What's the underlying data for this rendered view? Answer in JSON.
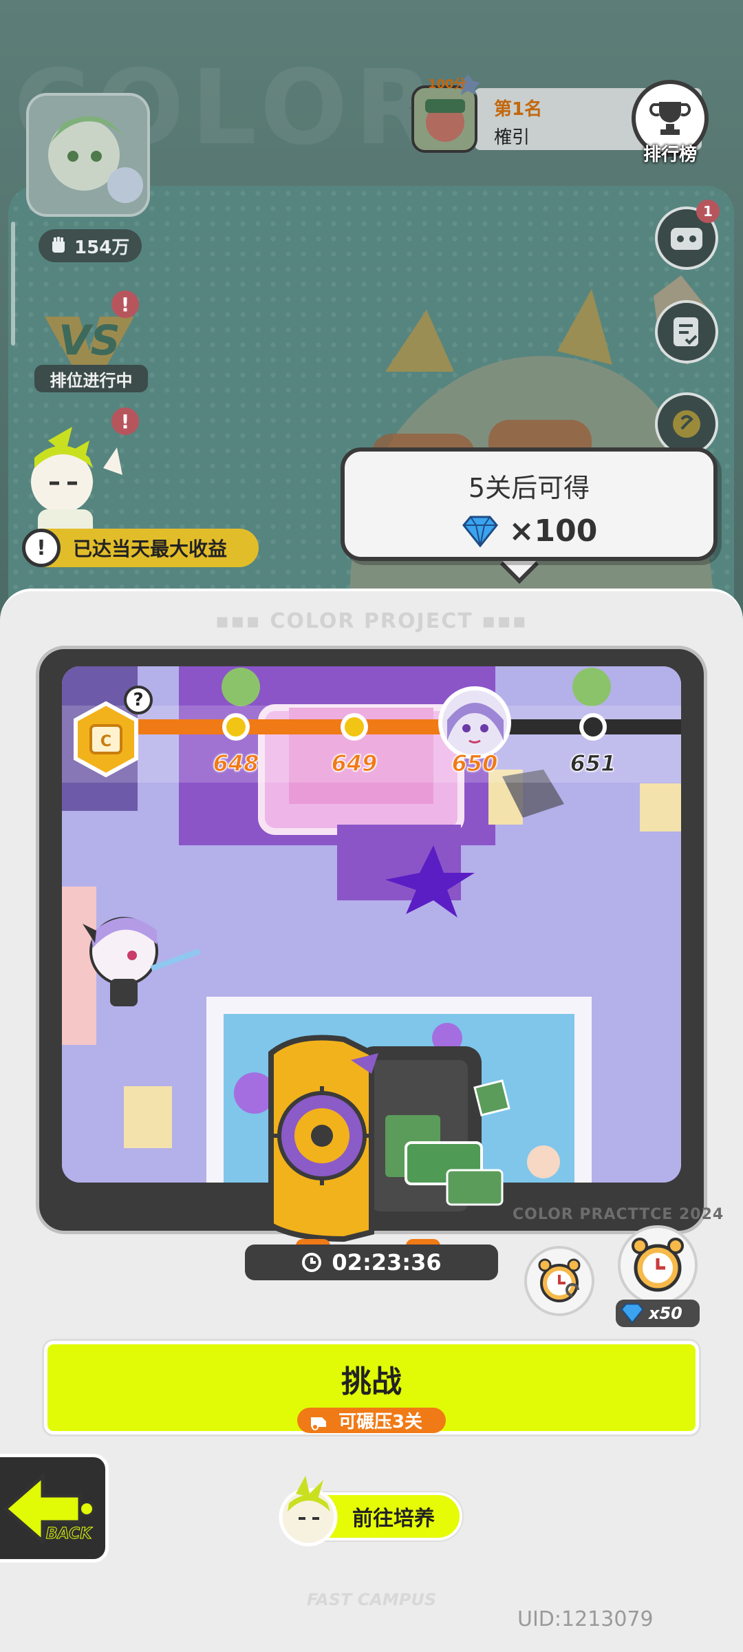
{
  "player": {
    "power": "154万"
  },
  "ranked": {
    "label": "排位进行中",
    "badge": "!"
  },
  "daily_notice": {
    "text": "已达当天最大收益",
    "icon": "!"
  },
  "leaderboard": {
    "top_rank": "第1名",
    "top_name": "榷引",
    "score_tag": "100分",
    "button_label": "排行榜"
  },
  "side_menu": {
    "mail_badge": "1"
  },
  "reward_bubble": {
    "title": "5关后可得",
    "amount": "×100"
  },
  "panel": {
    "project_title": "COLOR PROJECT",
    "watermark": "COLOR PRACTTCE 2024"
  },
  "stage_track": {
    "current_level": 650,
    "levels": [
      "648",
      "649",
      "650",
      "651"
    ],
    "help": "?"
  },
  "timer": {
    "remaining": "02:23:36"
  },
  "speedup": {
    "gem_cost": "x50"
  },
  "challenge_button": {
    "label": "挑战",
    "sub_label": "可碾压3关"
  },
  "back_button": {
    "label": "BACK"
  },
  "train_button": {
    "label": "前往培养"
  },
  "footer": {
    "campus": "FAST CAMPUS",
    "uid": "UID:1213079"
  },
  "colors": {
    "accent_yellow": "#e0fb05",
    "accent_orange": "#f07a16",
    "panel_dark": "#3b3b3b"
  }
}
